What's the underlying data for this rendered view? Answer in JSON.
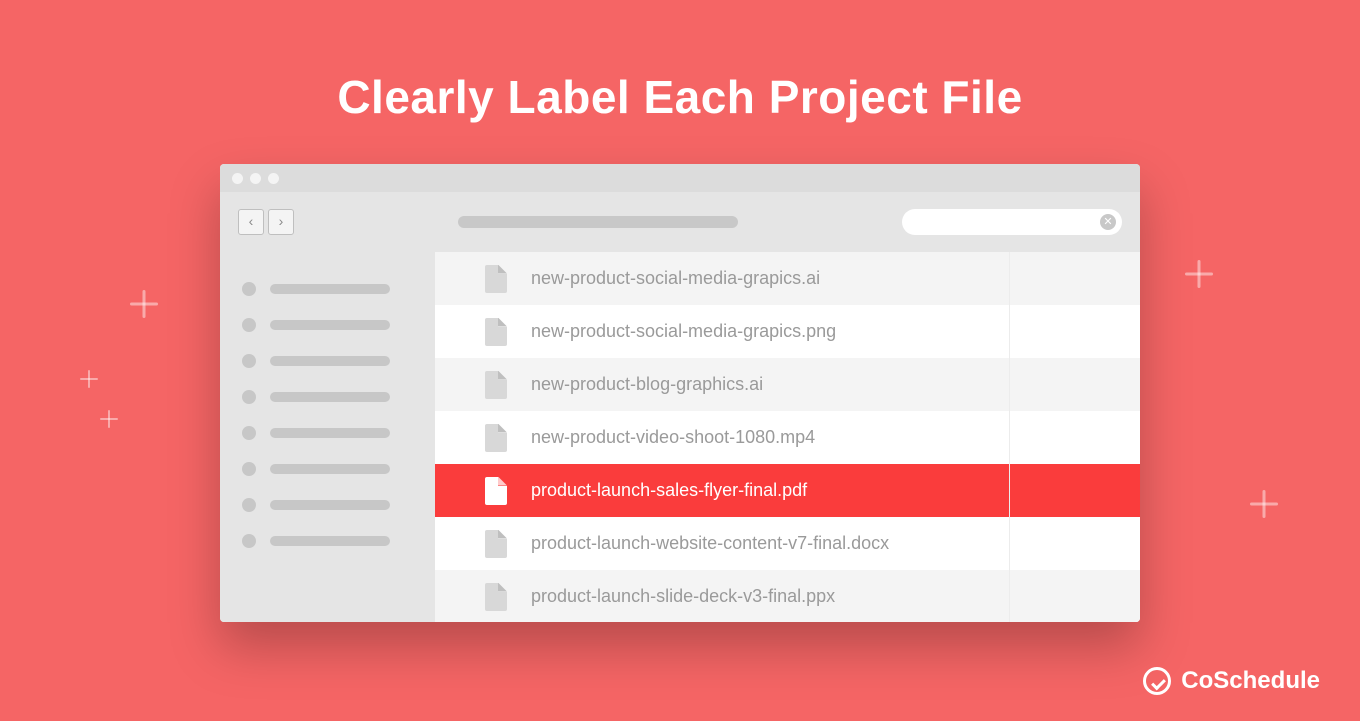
{
  "title": "Clearly Label Each Project File",
  "brand": "CoSchedule",
  "navigation": {
    "back_glyph": "‹",
    "forward_glyph": "›"
  },
  "files": [
    {
      "name": "new-product-social-media-grapics.ai",
      "selected": false
    },
    {
      "name": "new-product-social-media-grapics.png",
      "selected": false
    },
    {
      "name": "new-product-blog-graphics.ai",
      "selected": false
    },
    {
      "name": "new-product-video-shoot-1080.mp4",
      "selected": false
    },
    {
      "name": "product-launch-sales-flyer-final.pdf",
      "selected": true
    },
    {
      "name": "product-launch-website-content-v7-final.docx",
      "selected": false
    },
    {
      "name": "product-launch-slide-deck-v3-final.ppx",
      "selected": false
    }
  ]
}
